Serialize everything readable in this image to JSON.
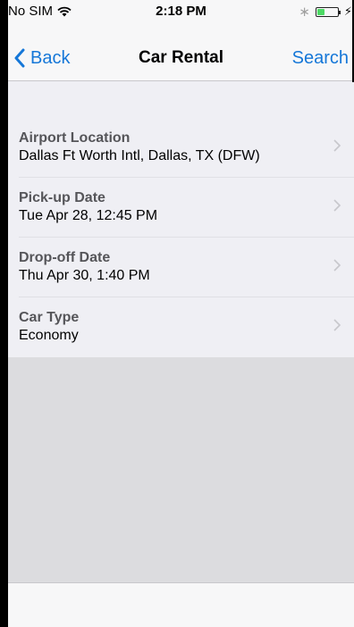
{
  "status_bar": {
    "carrier": "No SIM",
    "time": "2:18 PM",
    "battery_color": "#4cd964"
  },
  "nav": {
    "back_label": "Back",
    "title": "Car Rental",
    "action_label": "Search",
    "accent_color": "#1577d8"
  },
  "form": {
    "rows": [
      {
        "label": "Airport Location",
        "value": "Dallas Ft Worth Intl, Dallas, TX (DFW)"
      },
      {
        "label": "Pick-up Date",
        "value": "Tue Apr 28, 12:45 PM"
      },
      {
        "label": "Drop-off Date",
        "value": "Thu Apr 30, 1:40 PM"
      },
      {
        "label": "Car Type",
        "value": "Economy"
      }
    ]
  },
  "icons": {
    "wifi": "wifi-icon",
    "bluetooth": "bluetooth-icon",
    "battery": "battery-icon",
    "charging": "charging-bolt-icon",
    "back": "chevron-left-icon",
    "disclosure": "chevron-right-icon"
  }
}
